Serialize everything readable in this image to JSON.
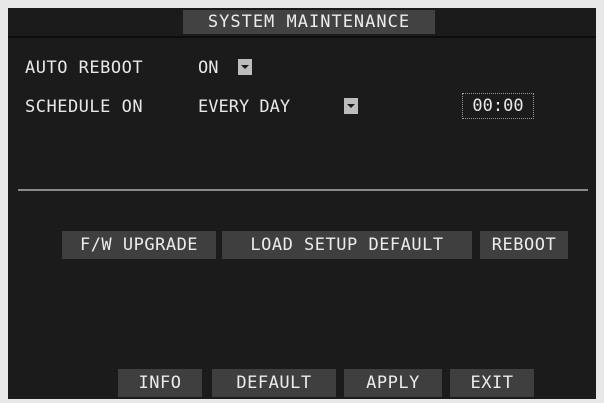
{
  "title": "SYSTEM MAINTENANCE",
  "auto_reboot": {
    "label": "AUTO REBOOT",
    "value": "ON"
  },
  "schedule": {
    "label": "SCHEDULE ON",
    "value": "EVERY DAY",
    "time": "00:00"
  },
  "actions": {
    "fw_upgrade": "F/W UPGRADE",
    "load_default": "LOAD SETUP DEFAULT",
    "reboot": "REBOOT"
  },
  "footer": {
    "info": "INFO",
    "default": "DEFAULT",
    "apply": "APPLY",
    "exit": "EXIT"
  }
}
